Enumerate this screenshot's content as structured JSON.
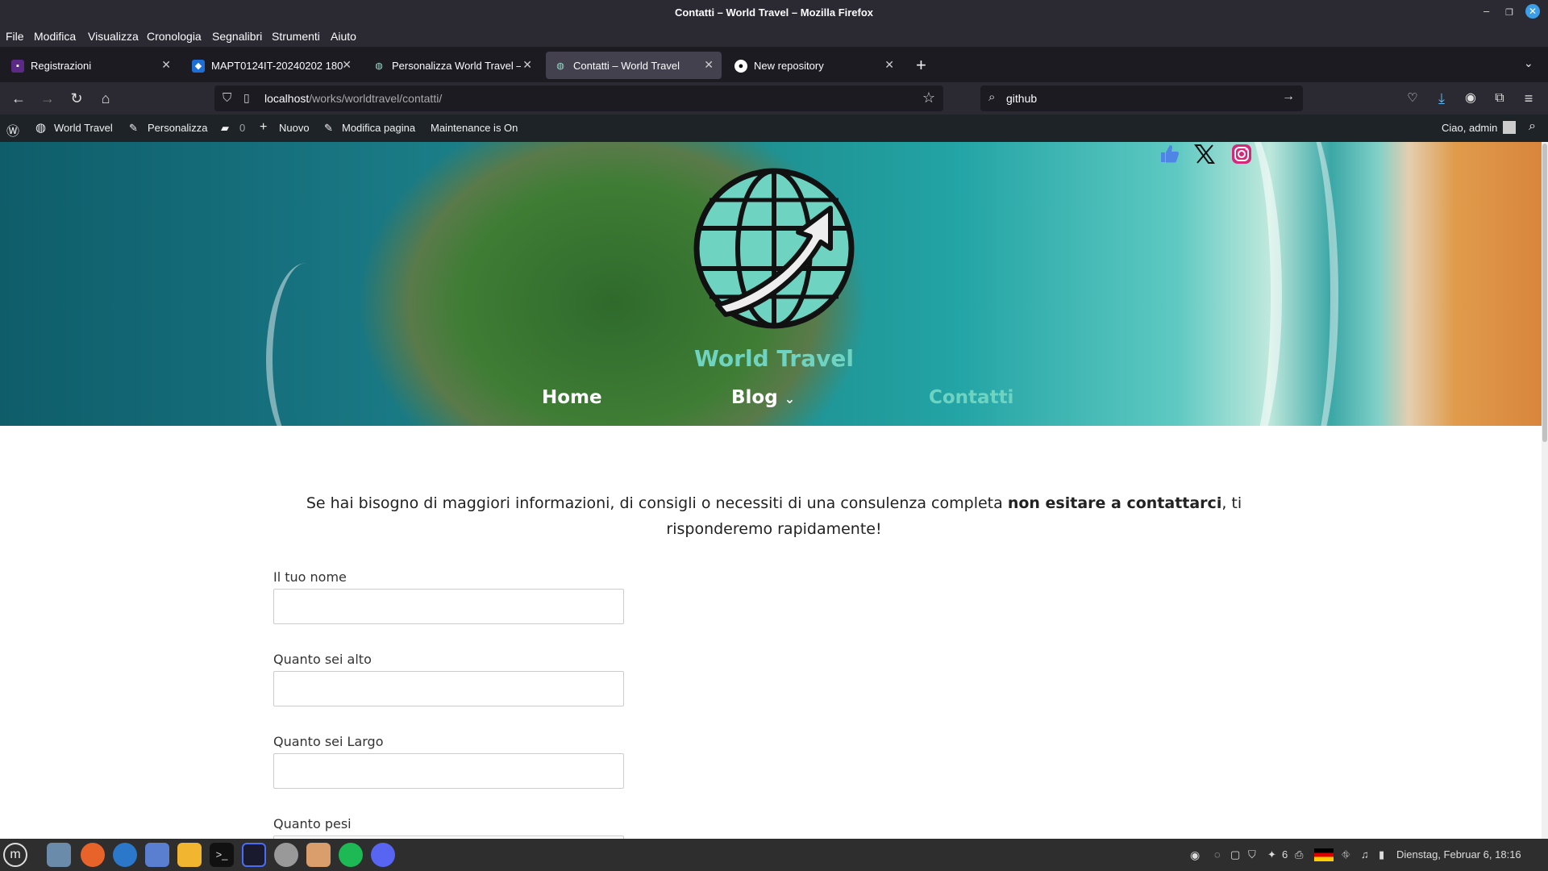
{
  "window": {
    "title": "Contatti – World Travel – Mozilla Firefox"
  },
  "menu": [
    "File",
    "Modifica",
    "Visualizza",
    "Cronologia",
    "Segnalibri",
    "Strumenti",
    "Aiuto"
  ],
  "tabs": [
    {
      "label": "Registrazioni",
      "icon": "page-icon",
      "active": false
    },
    {
      "label": "MAPT0124IT-20240202 180",
      "icon": "webex-icon",
      "active": false
    },
    {
      "label": "Personalizza World Travel –",
      "icon": "wordpress-icon",
      "active": false
    },
    {
      "label": "Contatti – World Travel",
      "icon": "wordpress-icon",
      "active": true
    },
    {
      "label": "New repository",
      "icon": "github-icon",
      "active": false
    }
  ],
  "url": {
    "host": "localhost",
    "path": "/works/worldtravel/contatti/"
  },
  "search": {
    "value": "github"
  },
  "wpadmin": {
    "site": "World Travel",
    "customize": "Personalizza",
    "comments": "0",
    "new": "Nuovo",
    "edit": "Modifica pagina",
    "maintenance": "Maintenance is On",
    "greeting": "Ciao, admin"
  },
  "site": {
    "name": "World Travel",
    "nav": [
      "Home",
      "Blog",
      "Contatti"
    ],
    "accent": "#6fd3c2"
  },
  "page": {
    "intro_before": "Se hai bisogno di maggiori informazioni, di consigli o necessiti di una consulenza completa ",
    "intro_bold": "non esitare a contattarci",
    "intro_after": ", ti risponderemo rapidamente!",
    "fields": [
      "Il tuo nome",
      "Quanto sei alto",
      "Quanto sei Largo",
      "Quanto pesi"
    ]
  },
  "taskbar": {
    "clock": "Dienstag, Februar  6, 18:16",
    "notification_count": "6"
  }
}
